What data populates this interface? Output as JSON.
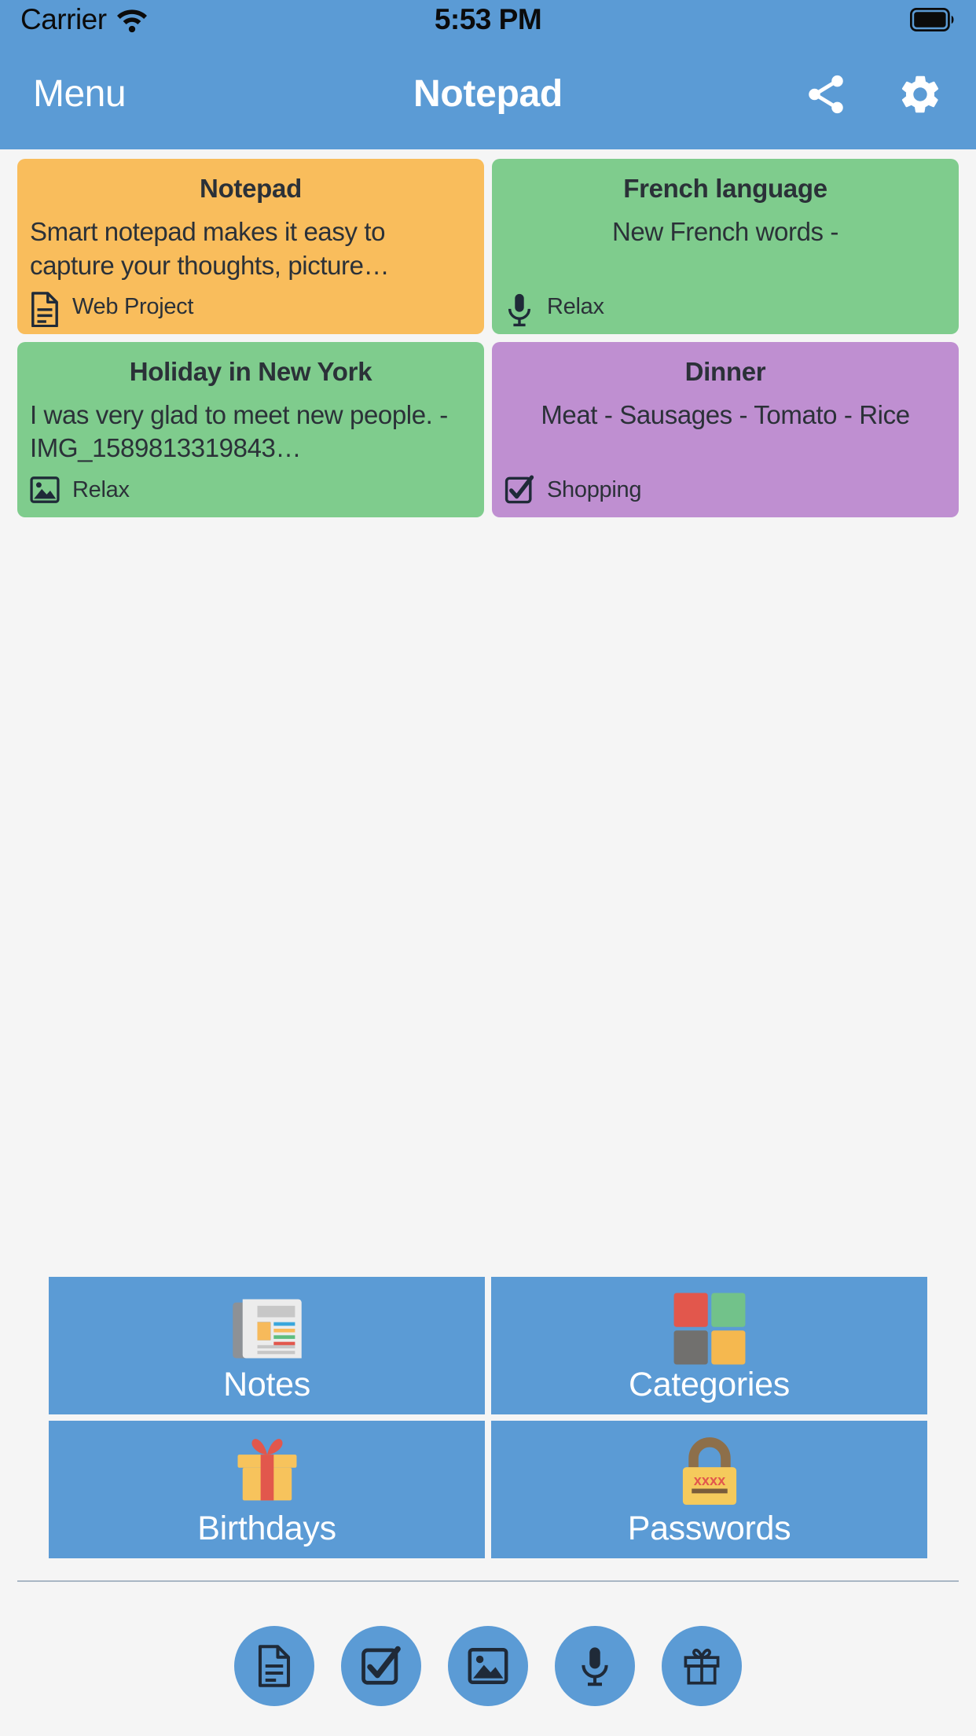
{
  "status_bar": {
    "carrier": "Carrier",
    "wifi_icon": "wifi-icon",
    "time": "5:53 PM",
    "battery_icon": "battery-full-icon"
  },
  "nav_bar": {
    "menu_label": "Menu",
    "title": "Notepad",
    "share_icon": "share-icon",
    "settings_icon": "gear-icon"
  },
  "notes": [
    {
      "title": "Notepad",
      "body": "Smart notepad makes it easy to capture your thoughts, picture…",
      "category": "Web Project",
      "icon": "document-icon",
      "color": "#f9bd5c",
      "align": "left"
    },
    {
      "title": "French language",
      "body": "New French words -",
      "category": "Relax",
      "icon": "microphone-icon",
      "color": "#7fcc8d",
      "align": "center"
    },
    {
      "title": "Holiday in New York",
      "body": "I was very glad to meet new people. - IMG_1589813319843…",
      "category": "Relax",
      "icon": "image-icon",
      "color": "#7fcc8d",
      "align": "left"
    },
    {
      "title": "Dinner",
      "body": "Meat - Sausages - Tomato - Rice",
      "category": "Shopping",
      "icon": "checkbox-icon",
      "color": "#bf8fd1",
      "align": "center"
    }
  ],
  "menu_tiles": [
    {
      "label": "Notes",
      "icon": "newspaper-icon"
    },
    {
      "label": "Categories",
      "icon": "color-squares-icon"
    },
    {
      "label": "Birthdays",
      "icon": "gift-box-icon"
    },
    {
      "label": "Passwords",
      "icon": "padlock-icon"
    }
  ],
  "toolbar": [
    {
      "icon": "document-icon",
      "name": "new-text-note"
    },
    {
      "icon": "checkbox-icon",
      "name": "new-checklist-note"
    },
    {
      "icon": "image-icon",
      "name": "new-image-note"
    },
    {
      "icon": "microphone-icon",
      "name": "new-voice-note"
    },
    {
      "icon": "gift-icon",
      "name": "new-birthday-note"
    }
  ],
  "colors": {
    "brand_blue": "#5b9bd5",
    "page_background": "#f5f5f5",
    "note_text": "#2b3138",
    "orange": "#f9bd5c",
    "green": "#7fcc8d",
    "purple": "#bf8fd1"
  }
}
